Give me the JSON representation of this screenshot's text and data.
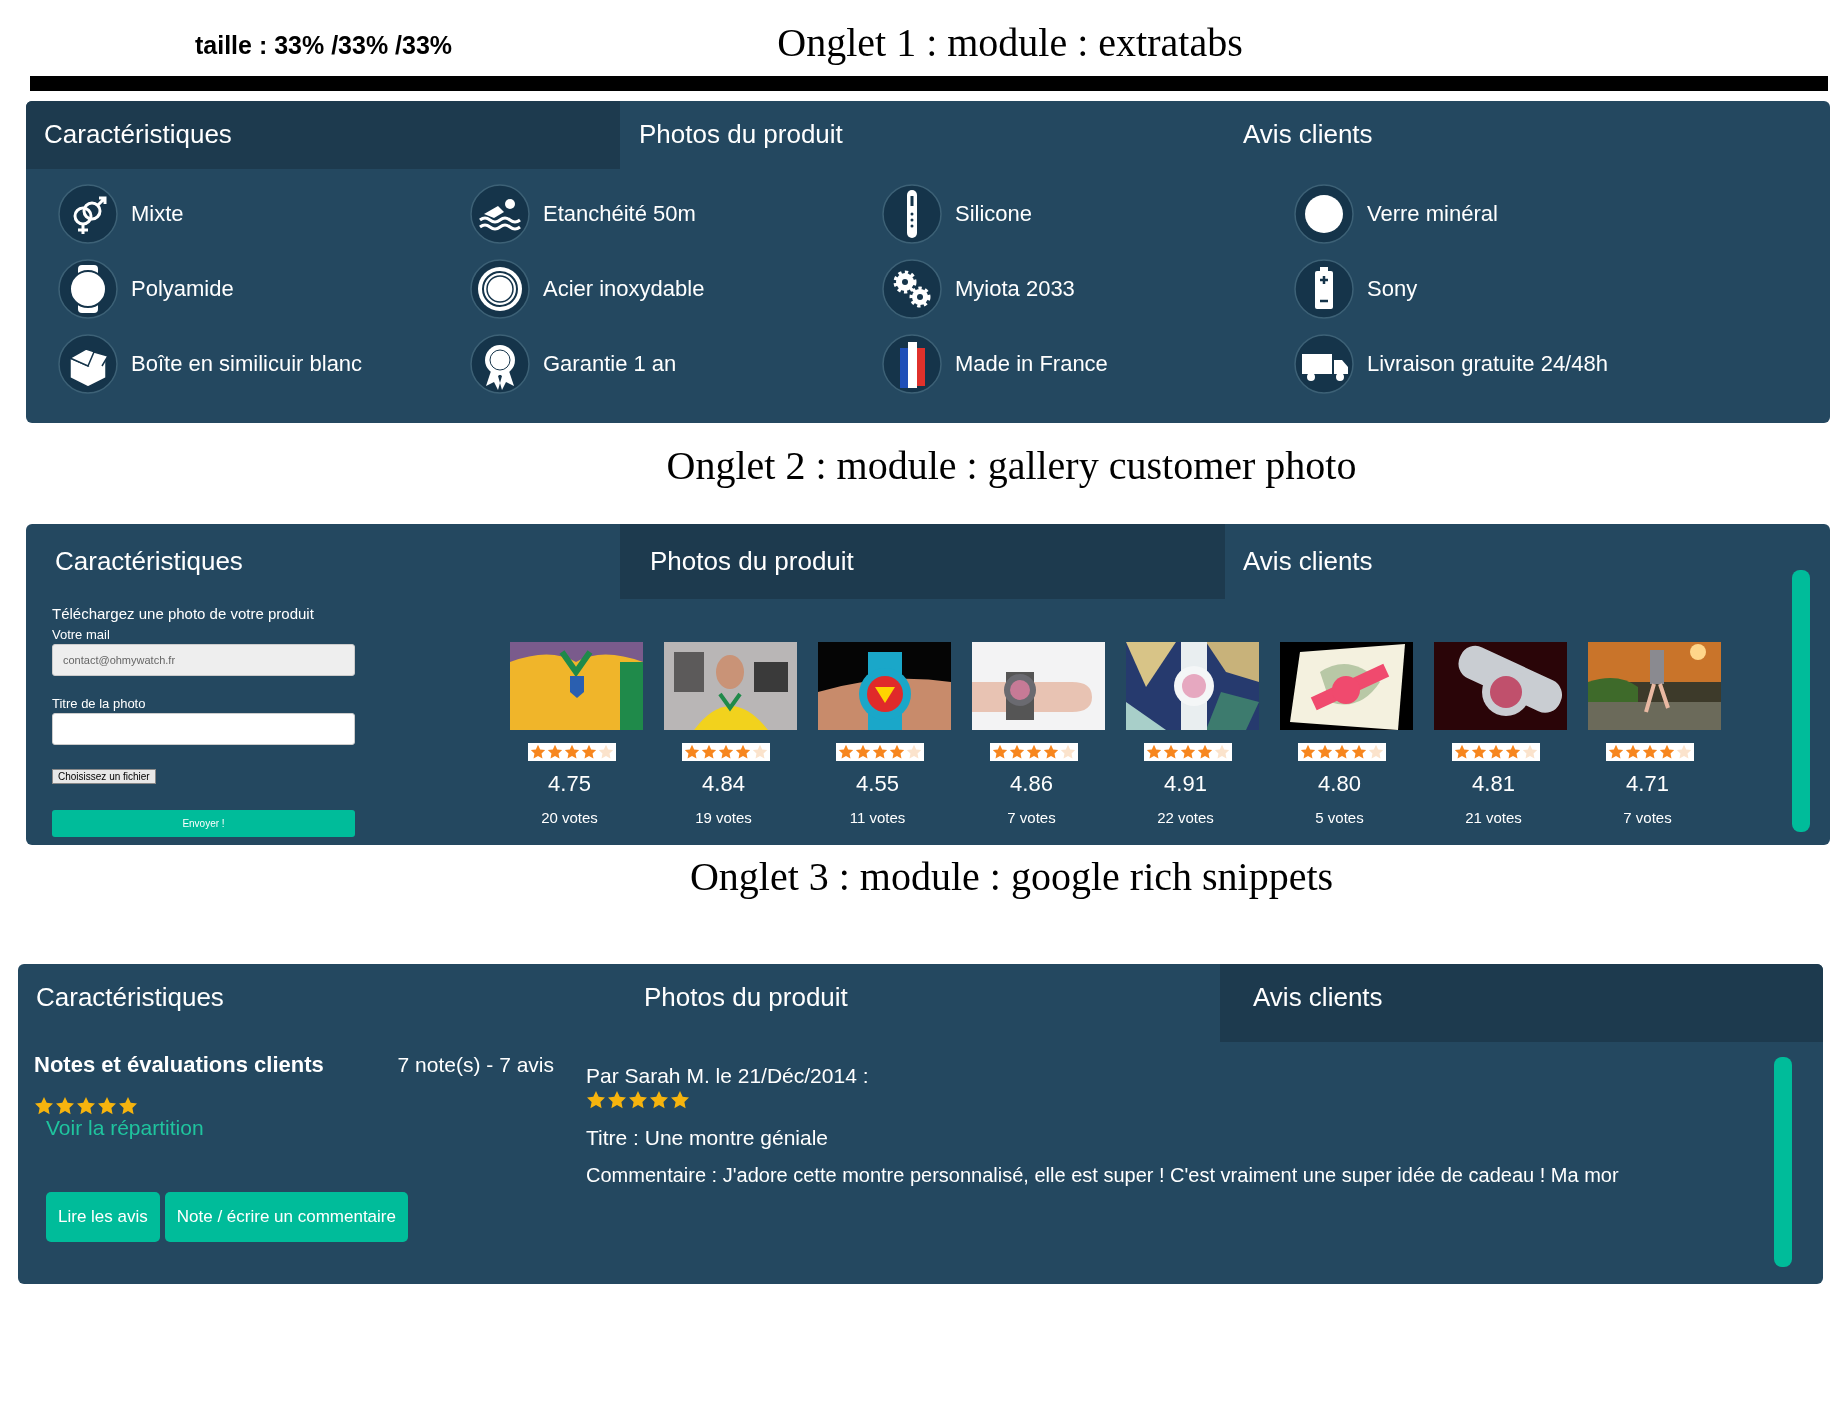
{
  "size_note": "taille : 33% /33% /33%",
  "sections": [
    {
      "kind": "extratabs",
      "heading": "Onglet 1 : module : extratabs",
      "tabs": [
        {
          "label": "Caractéristiques",
          "selected": true
        },
        {
          "label": "Photos du produit",
          "selected": false
        },
        {
          "label": "Avis clients",
          "selected": false
        }
      ],
      "features": [
        {
          "label": "Mixte"
        },
        {
          "label": "Etanchéité 50m"
        },
        {
          "label": "Silicone"
        },
        {
          "label": "Verre minéral"
        },
        {
          "label": "Polyamide"
        },
        {
          "label": "Acier inoxydable"
        },
        {
          "label": "Myiota 2033"
        },
        {
          "label": "Sony"
        },
        {
          "label": "Boîte en similicuir blanc"
        },
        {
          "label": "Garantie 1 an"
        },
        {
          "label": "Made in France"
        },
        {
          "label": "Livraison gratuite 24/48h"
        }
      ]
    },
    {
      "kind": "gallery",
      "heading": "Onglet 2 : module : gallery customer photo",
      "tabs": [
        {
          "label": "Caractéristiques",
          "selected": false
        },
        {
          "label": "Photos du produit",
          "selected": true
        },
        {
          "label": "Avis clients",
          "selected": false
        }
      ],
      "form": {
        "intro": "Téléchargez une photo de votre produit",
        "email_label": "Votre mail",
        "email_value": "contact@ohmywatch.fr",
        "title_label": "Titre de la photo",
        "file_button": "Choisissez un fichier",
        "submit": "Envoyer !"
      },
      "photos": [
        {
          "stars": 4,
          "rating": "4.75",
          "votes": "20 votes"
        },
        {
          "stars": 4,
          "rating": "4.84",
          "votes": "19 votes"
        },
        {
          "stars": 4,
          "rating": "4.55",
          "votes": "11 votes"
        },
        {
          "stars": 4,
          "rating": "4.86",
          "votes": "7 votes"
        },
        {
          "stars": 4,
          "rating": "4.91",
          "votes": "22 votes"
        },
        {
          "stars": 4,
          "rating": "4.80",
          "votes": "5 votes"
        },
        {
          "stars": 4,
          "rating": "4.81",
          "votes": "21 votes"
        },
        {
          "stars": 4,
          "rating": "4.71",
          "votes": "7 votes"
        }
      ]
    },
    {
      "kind": "reviews",
      "heading": "Onglet 3 : module : google rich snippets",
      "tabs": [
        {
          "label": "Caractéristiques",
          "selected": false
        },
        {
          "label": "Photos du produit",
          "selected": false
        },
        {
          "label": "Avis clients",
          "selected": true
        }
      ],
      "summary": {
        "title": "Notes et évaluations clients",
        "count": "7 note(s) - 7 avis",
        "stars": 5,
        "link": "Voir la répartition"
      },
      "buttons": [
        "Lire les avis",
        "Note / écrire un commentaire"
      ],
      "review": {
        "byline": "Par Sarah M. le 21/Déc/2014 :",
        "stars": 5,
        "title": "Titre : Une montre géniale",
        "comment": "Commentaire : J'adore cette montre personnalisé, elle est super ! C'est vraiment une super idée de cadeau ! Ma mor"
      }
    }
  ]
}
